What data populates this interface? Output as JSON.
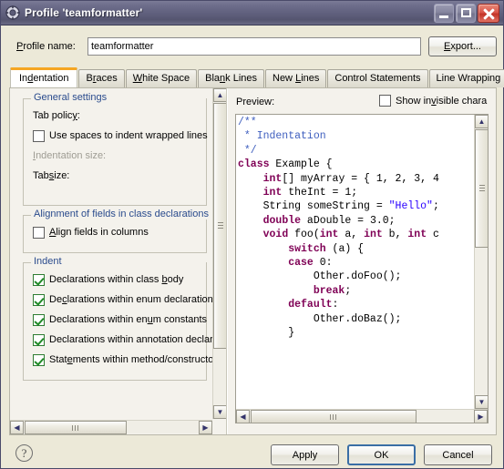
{
  "window": {
    "title": "Profile 'teamformatter'",
    "icon": "gear-icon",
    "controls": {
      "minimize": "–",
      "maximize": "□",
      "close": "✕"
    }
  },
  "profile": {
    "label": "Profile name:",
    "value": "teamformatter",
    "placeholder": "",
    "export_label": "Export..."
  },
  "tabs": [
    {
      "label": "Indentation",
      "selected": true
    },
    {
      "label": "Braces",
      "selected": false
    },
    {
      "label": "White Space",
      "selected": false
    },
    {
      "label": "Blank Lines",
      "selected": false
    },
    {
      "label": "New Lines",
      "selected": false
    },
    {
      "label": "Control Statements",
      "selected": false
    },
    {
      "label": "Line Wrapping",
      "selected": false
    }
  ],
  "tab_nav": {
    "prev": "◀",
    "next": "▶"
  },
  "settings": {
    "groups": [
      {
        "title": "General settings",
        "rows": [
          {
            "type": "label",
            "label": "Tab policy:",
            "disabled": false,
            "checked": false
          },
          {
            "type": "checkbox",
            "label": "Use spaces to indent wrapped lines",
            "disabled": false,
            "checked": false
          },
          {
            "type": "label",
            "label": "Indentation size:",
            "disabled": true,
            "checked": false
          },
          {
            "type": "label",
            "label": "Tab size:",
            "disabled": false,
            "checked": false
          }
        ]
      },
      {
        "title": "Alignment of fields in class declarations",
        "rows": [
          {
            "type": "checkbox",
            "label": "Align fields in columns",
            "disabled": false,
            "checked": false
          }
        ]
      },
      {
        "title": "Indent",
        "rows": [
          {
            "type": "checkbox",
            "label": "Declarations within class body",
            "disabled": false,
            "checked": true
          },
          {
            "type": "checkbox",
            "label": "Declarations within enum declaration",
            "disabled": false,
            "checked": true
          },
          {
            "type": "checkbox",
            "label": "Declarations within enum constants",
            "disabled": false,
            "checked": true
          },
          {
            "type": "checkbox",
            "label": "Declarations within annotation declar",
            "disabled": false,
            "checked": true
          },
          {
            "type": "checkbox",
            "label": "Statements within method/constructo",
            "disabled": false,
            "checked": true
          }
        ]
      }
    ]
  },
  "preview": {
    "label": "Preview:",
    "invisible_chars_label": "Show invisible chara",
    "invisible_chars_checked": false,
    "code_lines": [
      [
        {
          "t": "/**",
          "c": "cmt"
        }
      ],
      [
        {
          "t": " * Indentation",
          "c": "cmt"
        }
      ],
      [
        {
          "t": " */",
          "c": "cmt"
        }
      ],
      [
        {
          "t": "class",
          "c": "kw"
        },
        {
          "t": " Example {",
          "c": ""
        }
      ],
      [
        {
          "t": "    ",
          "c": ""
        },
        {
          "t": "int",
          "c": "kw"
        },
        {
          "t": "[] myArray = { 1, 2, 3, 4",
          "c": ""
        }
      ],
      [
        {
          "t": "    ",
          "c": ""
        },
        {
          "t": "int",
          "c": "kw"
        },
        {
          "t": " theInt = 1;",
          "c": ""
        }
      ],
      [
        {
          "t": "    String someString = ",
          "c": ""
        },
        {
          "t": "\"Hello\"",
          "c": "str"
        },
        {
          "t": ";",
          "c": ""
        }
      ],
      [
        {
          "t": "    ",
          "c": ""
        },
        {
          "t": "double",
          "c": "kw"
        },
        {
          "t": " aDouble = 3.0;",
          "c": ""
        }
      ],
      [
        {
          "t": "",
          "c": ""
        }
      ],
      [
        {
          "t": "    ",
          "c": ""
        },
        {
          "t": "void",
          "c": "kw"
        },
        {
          "t": " foo(",
          "c": ""
        },
        {
          "t": "int",
          "c": "kw"
        },
        {
          "t": " a, ",
          "c": ""
        },
        {
          "t": "int",
          "c": "kw"
        },
        {
          "t": " b, ",
          "c": ""
        },
        {
          "t": "int",
          "c": "kw"
        },
        {
          "t": " c",
          "c": ""
        }
      ],
      [
        {
          "t": "        ",
          "c": ""
        },
        {
          "t": "switch",
          "c": "kw"
        },
        {
          "t": " (a) {",
          "c": ""
        }
      ],
      [
        {
          "t": "        ",
          "c": ""
        },
        {
          "t": "case",
          "c": "kw"
        },
        {
          "t": " 0:",
          "c": ""
        }
      ],
      [
        {
          "t": "            Other.doFoo();",
          "c": ""
        }
      ],
      [
        {
          "t": "            ",
          "c": ""
        },
        {
          "t": "break",
          "c": "kw"
        },
        {
          "t": ";",
          "c": ""
        }
      ],
      [
        {
          "t": "        ",
          "c": ""
        },
        {
          "t": "default",
          "c": "kw"
        },
        {
          "t": ":",
          "c": ""
        }
      ],
      [
        {
          "t": "            Other.doBaz();",
          "c": ""
        }
      ],
      [
        {
          "t": "        }",
          "c": ""
        }
      ]
    ]
  },
  "footer": {
    "help": "?",
    "apply": "Apply",
    "ok": "OK",
    "cancel": "Cancel"
  },
  "scrollbars": {
    "up": "▲",
    "down": "▼",
    "left": "◀",
    "right": "▶"
  },
  "colors": {
    "titlebar": "#5f5f7c",
    "selected_tab_accent": "#f5a623",
    "group_title": "#2a4b8d",
    "keyword": "#7f0055",
    "comment": "#3f5fbf",
    "string": "#2a00ff",
    "dialog_bg": "#ece9d8",
    "close_button": "#c23327"
  }
}
